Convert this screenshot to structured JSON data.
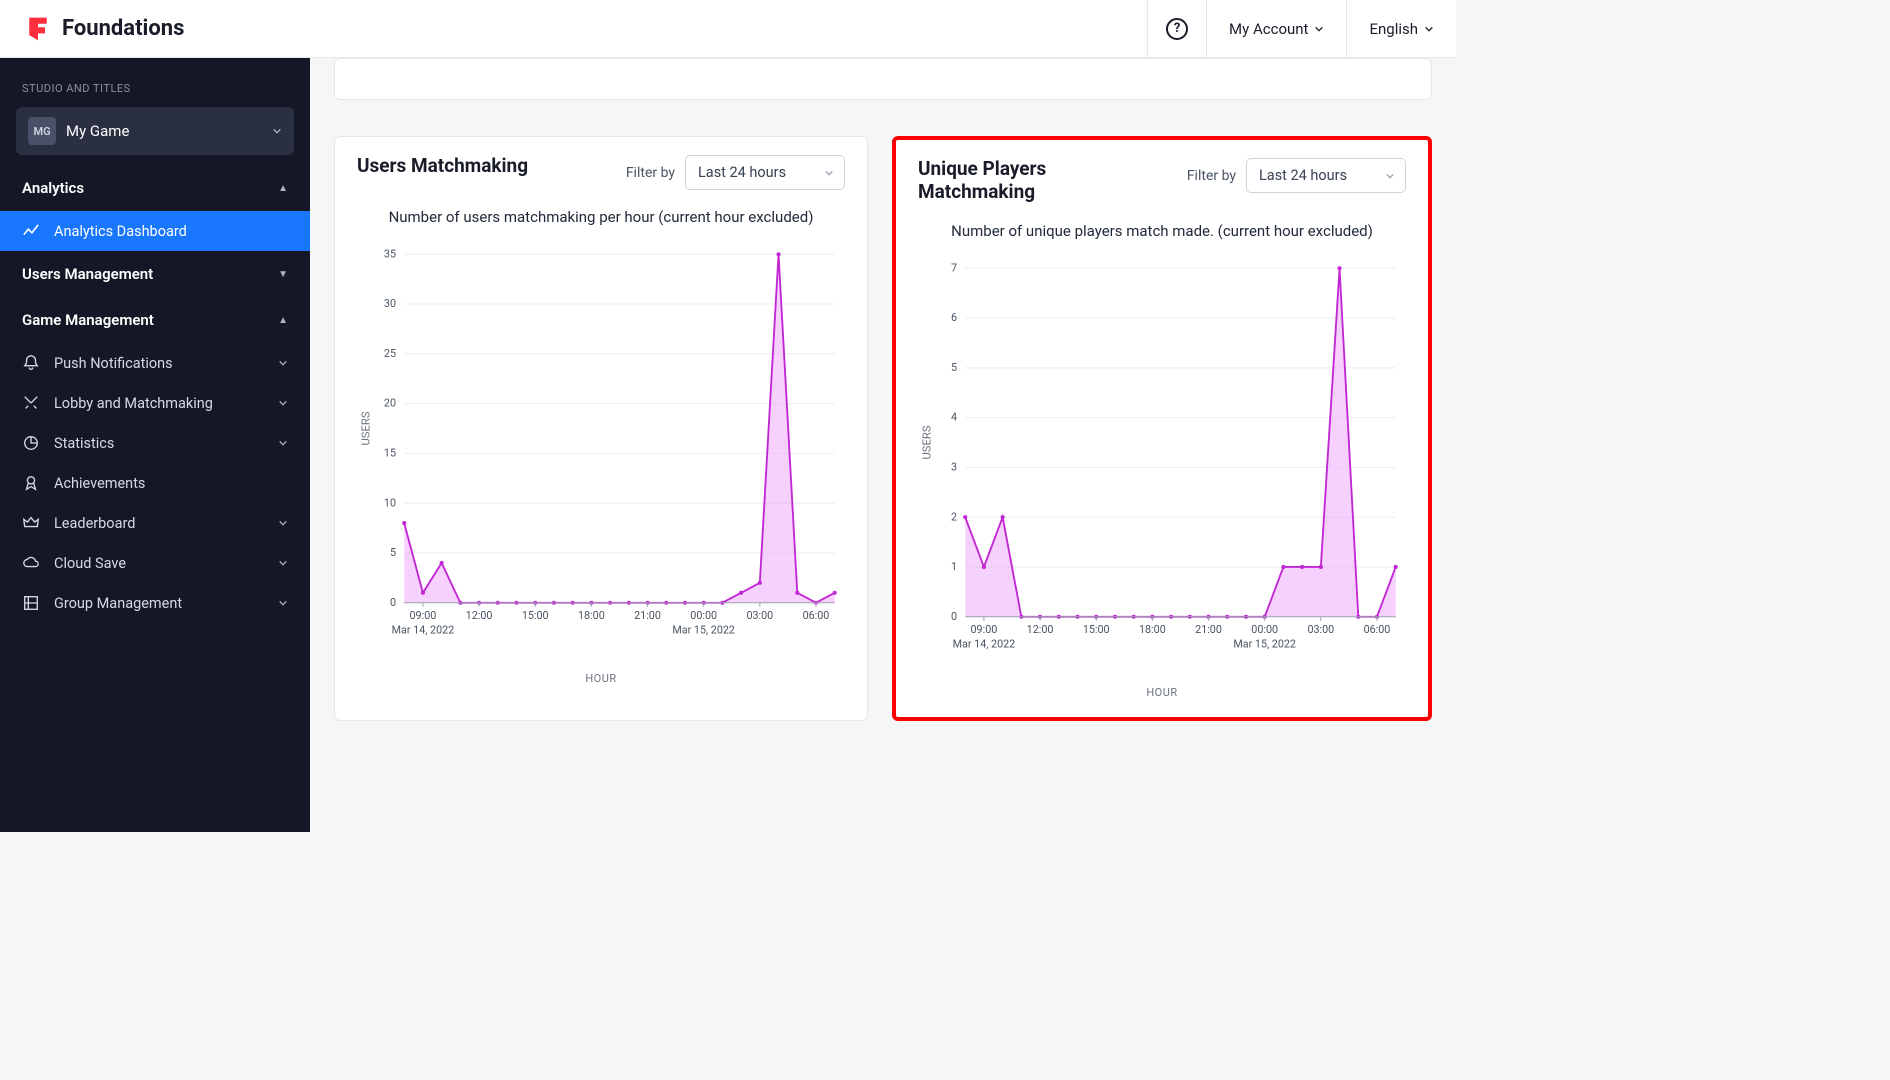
{
  "header": {
    "brand": "Foundations",
    "account": "My Account",
    "language": "English"
  },
  "sidebar": {
    "section_label": "STUDIO AND TITLES",
    "game": {
      "badge": "MG",
      "name": "My Game"
    },
    "sections": [
      {
        "label": "Analytics",
        "items": [
          "Analytics Dashboard"
        ]
      },
      {
        "label": "Users Management",
        "items": []
      },
      {
        "label": "Game Management",
        "items": [
          "Push Notifications",
          "Lobby and Matchmaking",
          "Statistics",
          "Achievements",
          "Leaderboard",
          "Cloud Save",
          "Group Management"
        ]
      }
    ]
  },
  "panels": [
    {
      "title": "Users Matchmaking",
      "filter_label": "Filter by",
      "filter_value": "Last 24 hours",
      "subtitle": "Number of users matchmaking per hour (current hour excluded)",
      "xlabel": "HOUR",
      "ylabel": "USERS",
      "date1": "Mar 14, 2022",
      "date2": "Mar 15, 2022"
    },
    {
      "title": "Unique Players Matchmaking",
      "filter_label": "Filter by",
      "filter_value": "Last 24 hours",
      "subtitle": "Number of unique players match made. (current hour excluded)",
      "xlabel": "HOUR",
      "ylabel": "USERS",
      "date1": "Mar 14, 2022",
      "date2": "Mar 15, 2022"
    }
  ],
  "chart_data": [
    {
      "type": "line",
      "title": "Users Matchmaking",
      "ylabel": "USERS",
      "xlabel": "HOUR",
      "ylim": [
        0,
        35
      ],
      "yticks": [
        0,
        5,
        10,
        15,
        20,
        25,
        30,
        35
      ],
      "xticks": [
        "09:00",
        "12:00",
        "15:00",
        "18:00",
        "21:00",
        "00:00",
        "03:00",
        "06:00"
      ],
      "date_labels": [
        "Mar 14, 2022",
        "Mar 15, 2022"
      ],
      "x": [
        "08:00",
        "09:00",
        "10:00",
        "11:00",
        "12:00",
        "13:00",
        "14:00",
        "15:00",
        "16:00",
        "17:00",
        "18:00",
        "19:00",
        "20:00",
        "21:00",
        "22:00",
        "23:00",
        "00:00",
        "01:00",
        "02:00",
        "03:00",
        "04:00",
        "05:00",
        "06:00",
        "07:00"
      ],
      "values": [
        8,
        1,
        4,
        0,
        0,
        0,
        0,
        0,
        0,
        0,
        0,
        0,
        0,
        0,
        0,
        0,
        0,
        0,
        1,
        2,
        35,
        1,
        0,
        1
      ]
    },
    {
      "type": "line",
      "title": "Unique Players Matchmaking",
      "ylabel": "USERS",
      "xlabel": "HOUR",
      "ylim": [
        0,
        7
      ],
      "yticks": [
        0,
        1,
        2,
        3,
        4,
        5,
        6,
        7
      ],
      "xticks": [
        "09:00",
        "12:00",
        "15:00",
        "18:00",
        "21:00",
        "00:00",
        "03:00",
        "06:00"
      ],
      "date_labels": [
        "Mar 14, 2022",
        "Mar 15, 2022"
      ],
      "x": [
        "08:00",
        "09:00",
        "10:00",
        "11:00",
        "12:00",
        "13:00",
        "14:00",
        "15:00",
        "16:00",
        "17:00",
        "18:00",
        "19:00",
        "20:00",
        "21:00",
        "22:00",
        "23:00",
        "00:00",
        "01:00",
        "02:00",
        "03:00",
        "04:00",
        "05:00",
        "06:00",
        "07:00"
      ],
      "values": [
        2,
        1,
        2,
        0,
        0,
        0,
        0,
        0,
        0,
        0,
        0,
        0,
        0,
        0,
        0,
        0,
        0,
        1,
        1,
        1,
        7,
        0,
        0,
        1
      ]
    }
  ]
}
